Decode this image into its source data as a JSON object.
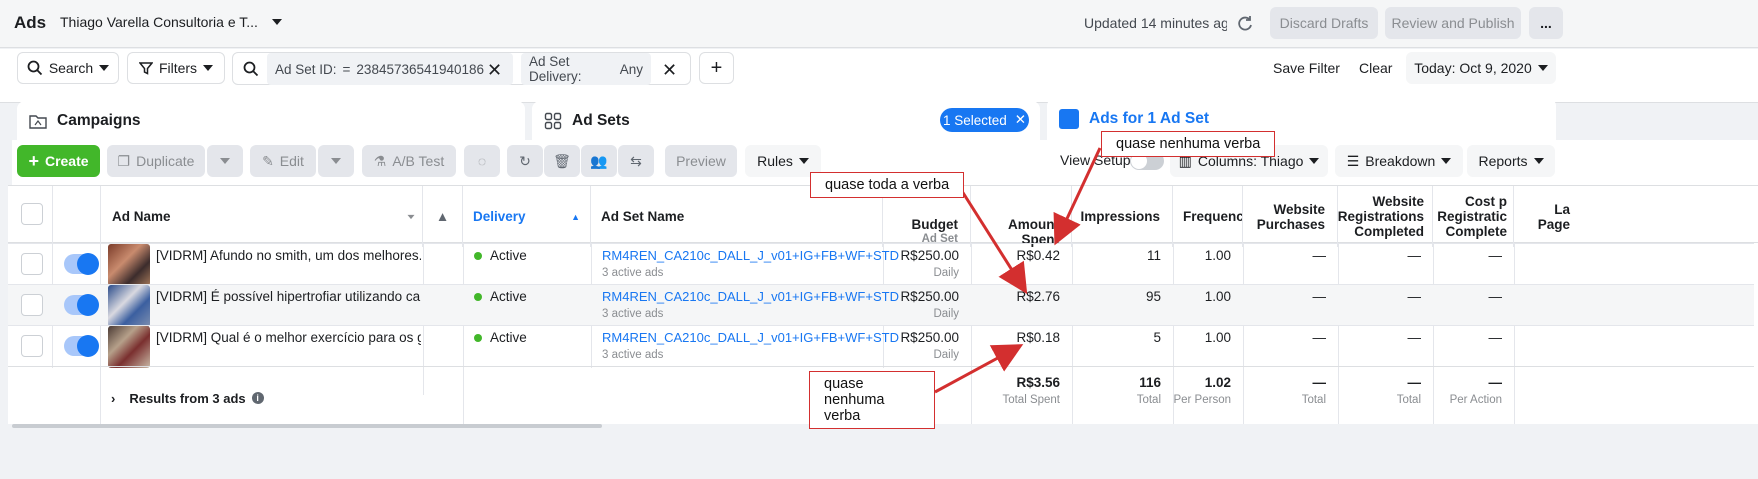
{
  "header": {
    "title": "Ads",
    "account": "Thiago Varella Consultoria e T...",
    "updated": "Updated 14 minutes ago",
    "discard": "Discard Drafts",
    "review": "Review and Publish",
    "more": "..."
  },
  "filters": {
    "search": "Search",
    "filters": "Filters",
    "adset_id_label": "Ad Set ID:",
    "adset_id_op": "=",
    "adset_id_value": "23845736541940186",
    "delivery_label": "Ad Set Delivery:",
    "delivery_value": "Any",
    "save_filter": "Save Filter",
    "clear": "Clear",
    "date": "Today: Oct 9, 2020"
  },
  "tabs": {
    "campaigns": "Campaigns",
    "adsets": "Ad Sets",
    "selected": "1 Selected",
    "ads": "Ads for 1 Ad Set"
  },
  "toolbar": {
    "create": "Create",
    "duplicate": "Duplicate",
    "edit": "Edit",
    "abtest": "A/B Test",
    "preview": "Preview",
    "rules": "Rules",
    "view_setup": "View Setup",
    "columns": "Columns: Thiago",
    "breakdown": "Breakdown",
    "reports": "Reports"
  },
  "columns": {
    "ad_name": "Ad Name",
    "delivery": "Delivery",
    "adset_name": "Ad Set Name",
    "budget": "Budget",
    "budget_sub": "Ad Set",
    "amount_1": "Amount",
    "amount_2": "Spent",
    "impressions": "Impressions",
    "frequency": "Frequenc",
    "purch_1": "Website",
    "purch_2": "Purchases",
    "reg_1": "Website",
    "reg_2": "Registrations",
    "reg_3": "Completed",
    "cost_1": "Cost p",
    "cost_2": "Registratic",
    "cost_3": "Complete",
    "last_1": "La",
    "last_2": "Page"
  },
  "rows": [
    {
      "ad_name": "[VIDRM] Afundo no smith, um dos melhores...",
      "delivery": "Active",
      "adset": "RM4REN_CA210c_DALL_J_v01+IG+FB+WF+STD",
      "adset_sub": "3 active ads",
      "budget": "R$250.00",
      "budget_sub": "Daily",
      "spent": "R$0.42",
      "impressions": "11",
      "frequency": "1.00",
      "purchases": "—",
      "registrations": "—",
      "cost": "—"
    },
    {
      "ad_name": "[VIDRM] É possível hipertrofiar utilizando ca...",
      "delivery": "Active",
      "adset": "RM4REN_CA210c_DALL_J_v01+IG+FB+WF+STD",
      "adset_sub": "3 active ads",
      "budget": "R$250.00",
      "budget_sub": "Daily",
      "spent": "R$2.76",
      "impressions": "95",
      "frequency": "1.00",
      "purchases": "—",
      "registrations": "—",
      "cost": "—"
    },
    {
      "ad_name": "[VIDRM] Qual é o melhor exercício para os g...",
      "delivery": "Active",
      "adset": "RM4REN_CA210c_DALL_J_v01+IG+FB+WF+STD",
      "adset_sub": "3 active ads",
      "budget": "R$250.00",
      "budget_sub": "Daily",
      "spent": "R$0.18",
      "impressions": "5",
      "frequency": "1.00",
      "purchases": "—",
      "registrations": "—",
      "cost": "—"
    }
  ],
  "totals": {
    "label": "Results from 3 ads",
    "spent": "R$3.56",
    "spent_sub": "Total Spent",
    "impressions": "116",
    "impressions_sub": "Total",
    "frequency": "1.02",
    "frequency_sub": "Per Person",
    "purchases": "—",
    "purchases_sub": "Total",
    "registrations": "—",
    "registrations_sub": "Total",
    "cost": "—",
    "cost_sub": "Per Action"
  },
  "annotations": {
    "top": "quase nenhuma verba",
    "middle": "quase toda a verba",
    "bottom_1": "quase",
    "bottom_2": "nenhuma verba"
  },
  "colors": {
    "accent": "#1877f2",
    "create": "#42b72a",
    "callout_arrow": "#d32f2f"
  }
}
